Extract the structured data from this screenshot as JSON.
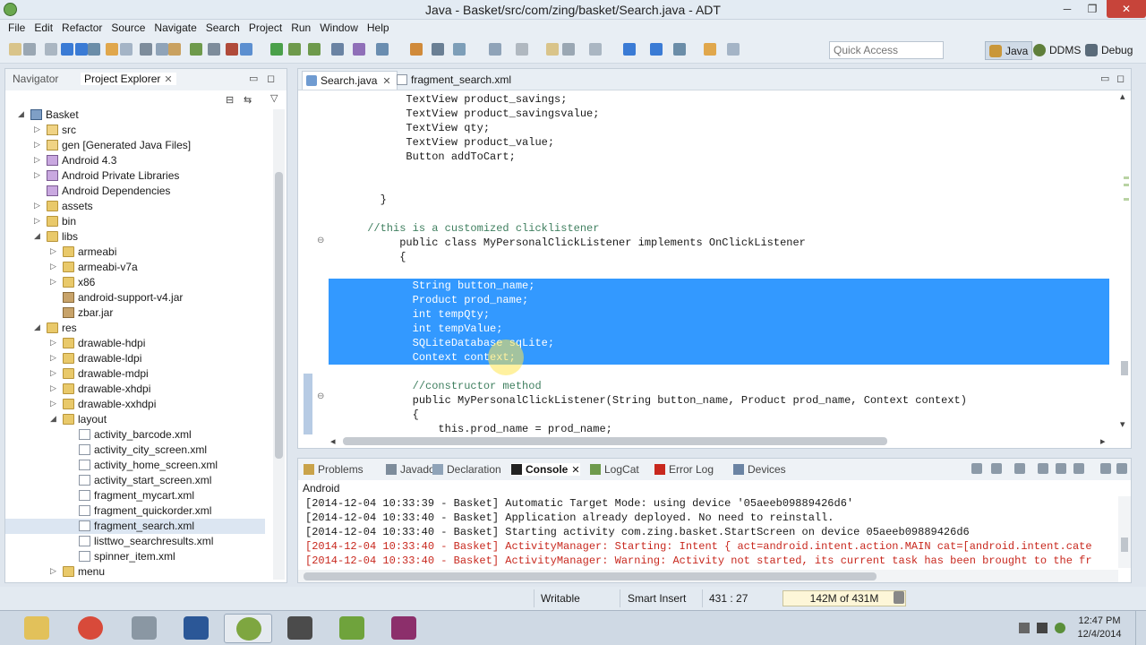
{
  "window": {
    "title": "Java - Basket/src/com/zing/basket/Search.java - ADT",
    "minimize": "─",
    "restore": "❐",
    "close": "✕"
  },
  "menu": [
    "File",
    "Edit",
    "Refactor",
    "Source",
    "Navigate",
    "Search",
    "Project",
    "Run",
    "Window",
    "Help"
  ],
  "toolbar": {
    "quick_access_placeholder": "Quick Access",
    "perspectives": [
      {
        "label": "Java",
        "active": true,
        "color": "#c9973a"
      },
      {
        "label": "DDMS",
        "active": false,
        "color": "#5f7f3b"
      },
      {
        "label": "Debug",
        "active": false,
        "color": "#5a6b7a"
      }
    ]
  },
  "left_panel": {
    "tabs": [
      {
        "label": "Navigator",
        "active": false
      },
      {
        "label": "Project Explorer",
        "active": true,
        "close": "✕"
      }
    ],
    "controls": {
      "minimize": "▭",
      "maximize": "◻",
      "collapse": "⊟",
      "link": "⇆",
      "menu": "▽"
    },
    "tree": [
      {
        "label": "Basket",
        "level": 0,
        "expanded": true,
        "icon": "proj"
      },
      {
        "label": "src",
        "level": 1,
        "expanded": false,
        "icon": "pkg"
      },
      {
        "label": "gen [Generated Java Files]",
        "level": 1,
        "expanded": false,
        "icon": "pkg"
      },
      {
        "label": "Android 4.3",
        "level": 1,
        "expanded": false,
        "icon": "lib"
      },
      {
        "label": "Android Private Libraries",
        "level": 1,
        "expanded": false,
        "icon": "lib"
      },
      {
        "label": "Android Dependencies",
        "level": 1,
        "expanded": null,
        "icon": "lib"
      },
      {
        "label": "assets",
        "level": 1,
        "expanded": false,
        "icon": "folder"
      },
      {
        "label": "bin",
        "level": 1,
        "expanded": false,
        "icon": "folder"
      },
      {
        "label": "libs",
        "level": 1,
        "expanded": true,
        "icon": "folder"
      },
      {
        "label": "armeabi",
        "level": 2,
        "expanded": false,
        "icon": "folder"
      },
      {
        "label": "armeabi-v7a",
        "level": 2,
        "expanded": false,
        "icon": "folder"
      },
      {
        "label": "x86",
        "level": 2,
        "expanded": false,
        "icon": "folder"
      },
      {
        "label": "android-support-v4.jar",
        "level": 2,
        "expanded": null,
        "icon": "jar"
      },
      {
        "label": "zbar.jar",
        "level": 2,
        "expanded": null,
        "icon": "jar"
      },
      {
        "label": "res",
        "level": 1,
        "expanded": true,
        "icon": "folder"
      },
      {
        "label": "drawable-hdpi",
        "level": 2,
        "expanded": false,
        "icon": "folder"
      },
      {
        "label": "drawable-ldpi",
        "level": 2,
        "expanded": false,
        "icon": "folder"
      },
      {
        "label": "drawable-mdpi",
        "level": 2,
        "expanded": false,
        "icon": "folder"
      },
      {
        "label": "drawable-xhdpi",
        "level": 2,
        "expanded": false,
        "icon": "folder"
      },
      {
        "label": "drawable-xxhdpi",
        "level": 2,
        "expanded": false,
        "icon": "folder"
      },
      {
        "label": "layout",
        "level": 2,
        "expanded": true,
        "icon": "folder"
      },
      {
        "label": "activity_barcode.xml",
        "level": 3,
        "expanded": null,
        "icon": "xml"
      },
      {
        "label": "activity_city_screen.xml",
        "level": 3,
        "expanded": null,
        "icon": "xml"
      },
      {
        "label": "activity_home_screen.xml",
        "level": 3,
        "expanded": null,
        "icon": "xml"
      },
      {
        "label": "activity_start_screen.xml",
        "level": 3,
        "expanded": null,
        "icon": "xml"
      },
      {
        "label": "fragment_mycart.xml",
        "level": 3,
        "expanded": null,
        "icon": "xml"
      },
      {
        "label": "fragment_quickorder.xml",
        "level": 3,
        "expanded": null,
        "icon": "xml"
      },
      {
        "label": "fragment_search.xml",
        "level": 3,
        "expanded": null,
        "icon": "xml",
        "selected": true
      },
      {
        "label": "listtwo_searchresults.xml",
        "level": 3,
        "expanded": null,
        "icon": "xml"
      },
      {
        "label": "spinner_item.xml",
        "level": 3,
        "expanded": null,
        "icon": "xml"
      },
      {
        "label": "menu",
        "level": 2,
        "expanded": false,
        "icon": "folder"
      }
    ]
  },
  "editor": {
    "tabs": [
      {
        "label": "Search.java",
        "active": true,
        "close": "✕"
      },
      {
        "label": "fragment_search.xml",
        "active": false
      }
    ],
    "lines": [
      {
        "text": "            TextView product_savings;",
        "indent": 0
      },
      {
        "text": "            TextView product_savingsvalue;",
        "indent": 0
      },
      {
        "text": "            TextView qty;",
        "indent": 0
      },
      {
        "text": "            TextView product_value;",
        "indent": 0
      },
      {
        "text": "            Button addToCart;",
        "indent": 0
      },
      {
        "text": "",
        "indent": 0
      },
      {
        "text": "",
        "indent": 0
      },
      {
        "text": "        }",
        "indent": 0
      },
      {
        "text": "",
        "indent": 0
      },
      {
        "text": "      //this is a customized clicklistener",
        "comment": true
      },
      {
        "text": "           public class MyPersonalClickListener implements OnClickListener",
        "indent": 0
      },
      {
        "text": "           {",
        "indent": 0
      },
      {
        "text": "",
        "indent": 0
      },
      {
        "text": "             String button_name;",
        "selected": true
      },
      {
        "text": "             Product prod_name;",
        "selected": true
      },
      {
        "text": "             int tempQty;",
        "selected": true
      },
      {
        "text": "             int tempValue;",
        "selected": true
      },
      {
        "text": "             SQLiteDatabase sqLite;",
        "selected": true
      },
      {
        "text": "             Context context;",
        "selected": true
      },
      {
        "text": "",
        "indent": 0
      },
      {
        "text": "             //constructor method",
        "comment": true
      },
      {
        "text": "             public MyPersonalClickListener(String button_name, Product prod_name, Context context)",
        "indent": 0
      },
      {
        "text": "             {",
        "indent": 0
      },
      {
        "text": "                 this.prod_name = prod_name;",
        "indent": 0
      }
    ]
  },
  "console": {
    "tabs": [
      {
        "label": "Problems",
        "active": false
      },
      {
        "label": "Javadoc",
        "active": false
      },
      {
        "label": "Declaration",
        "active": false
      },
      {
        "label": "Console",
        "active": true,
        "close": "✕"
      },
      {
        "label": "LogCat",
        "active": false
      },
      {
        "label": "Error Log",
        "active": false
      },
      {
        "label": "Devices",
        "active": false
      }
    ],
    "header": "Android",
    "lines": [
      {
        "text": "[2014-12-04 10:33:39 - Basket] Automatic Target Mode: using device '05aeeb09889426d6'",
        "error": false
      },
      {
        "text": "[2014-12-04 10:33:40 - Basket] Application already deployed. No need to reinstall.",
        "error": false
      },
      {
        "text": "[2014-12-04 10:33:40 - Basket] Starting activity com.zing.basket.StartScreen on device 05aeeb09889426d6",
        "error": false
      },
      {
        "text": "[2014-12-04 10:33:40 - Basket] ActivityManager: Starting: Intent { act=android.intent.action.MAIN cat=[android.intent.cate",
        "error": true
      },
      {
        "text": "[2014-12-04 10:33:40 - Basket] ActivityManager: Warning: Activity not started, its current task has been brought to the fr",
        "error": true
      }
    ]
  },
  "status": {
    "writable": "Writable",
    "insert_mode": "Smart Insert",
    "position": "431 : 27",
    "heap": "142M of 431M"
  },
  "taskbar": {
    "apps": [
      {
        "name": "explorer",
        "color": "#e2c15a"
      },
      {
        "name": "chrome",
        "color": "#d84a3a"
      },
      {
        "name": "notepad",
        "color": "#8a97a3"
      },
      {
        "name": "word",
        "color": "#2b5797"
      },
      {
        "name": "eclipse-adt",
        "color": "#7ea640",
        "active": true
      },
      {
        "name": "sublime",
        "color": "#4b4b4b"
      },
      {
        "name": "camtasia",
        "color": "#6fa33c"
      },
      {
        "name": "recorder",
        "color": "#8c2f6b"
      }
    ],
    "time": "12:47 PM",
    "date": "12/4/2014"
  }
}
